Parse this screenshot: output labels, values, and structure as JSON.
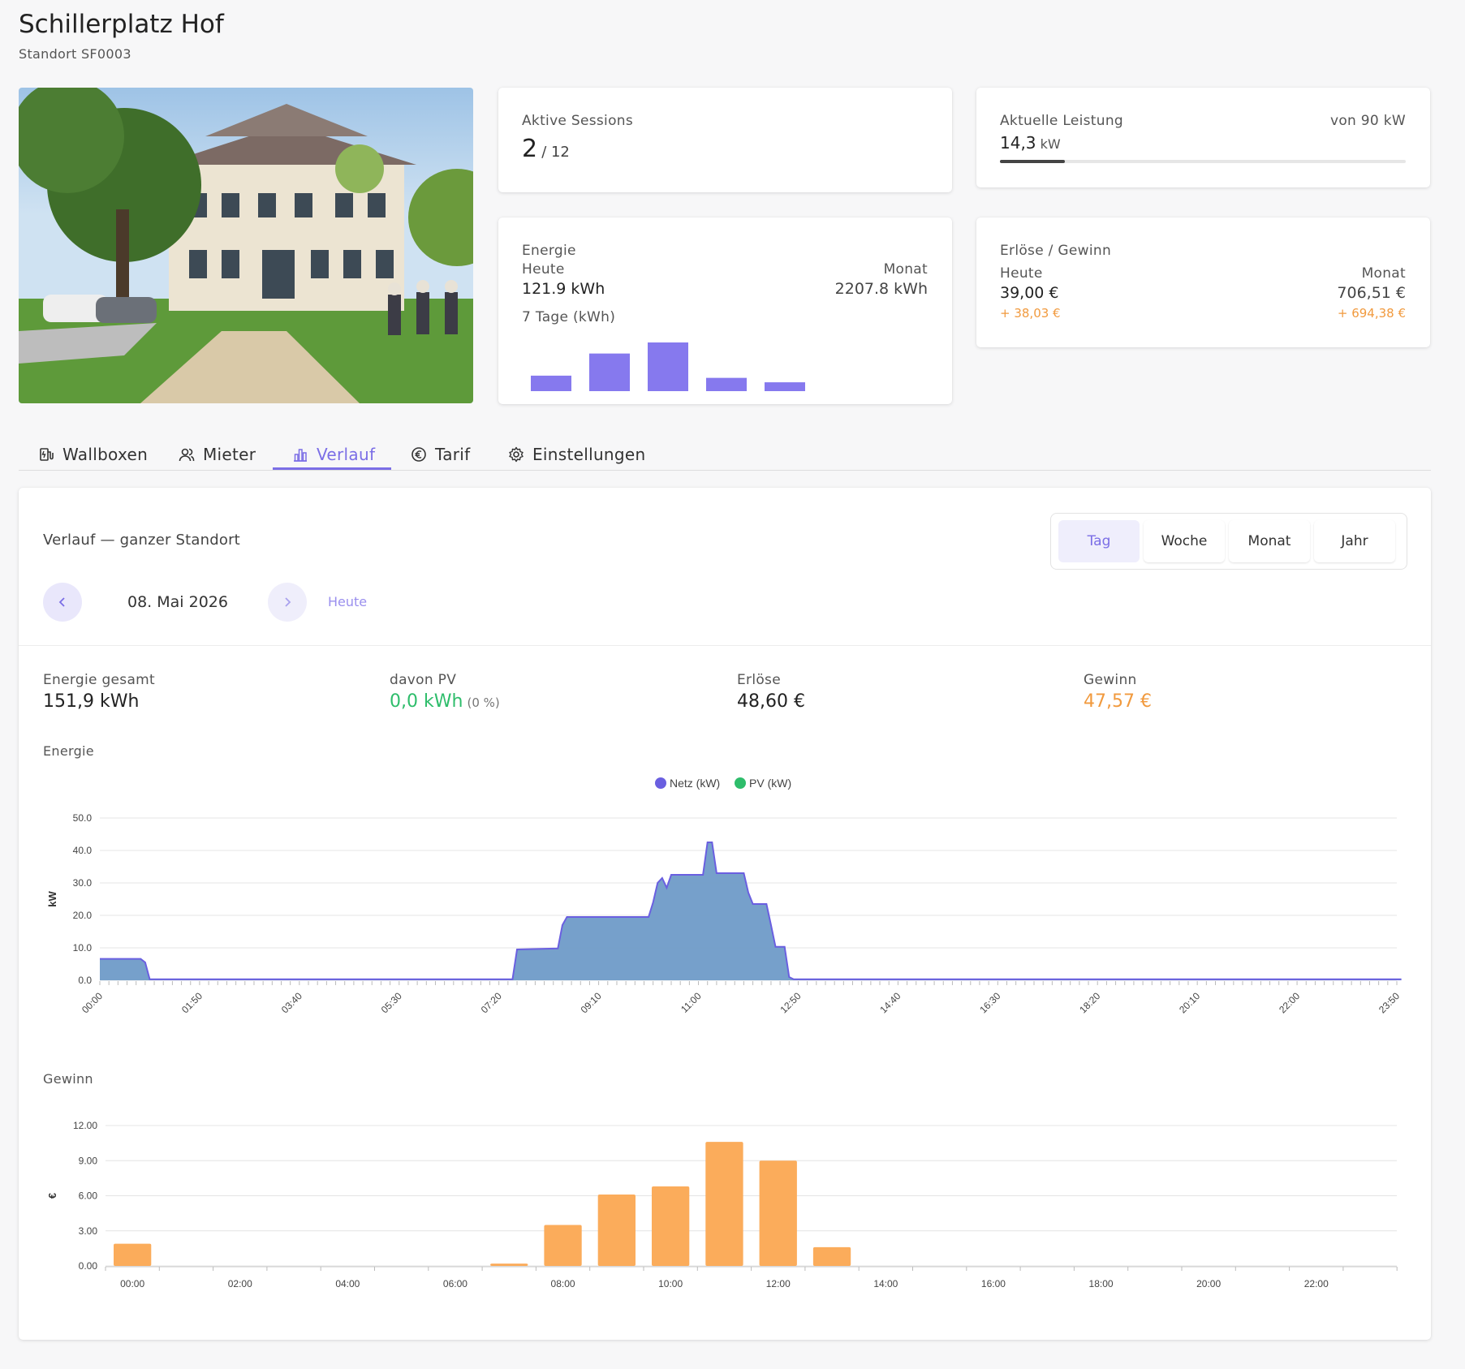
{
  "header": {
    "title": "Schillerplatz Hof",
    "subtitle": "Standort SF0003"
  },
  "kpis": {
    "sessions": {
      "label": "Aktive Sessions",
      "value": "2",
      "total": "/ 12"
    },
    "power": {
      "label": "Aktuelle Leistung",
      "value": "14,3",
      "unit": "kW",
      "max_label": "von 90 kW",
      "fraction": 0.159
    },
    "energy": {
      "label": "Energie",
      "today_label": "Heute",
      "today_value": "121.9 kWh",
      "month_label": "Monat",
      "month_value": "2207.8 kWh",
      "week_label": "7 Tage (kWh)",
      "week_values": [
        35,
        85,
        110,
        30,
        20
      ]
    },
    "revenue": {
      "label": "Erlöse / Gewinn",
      "today_label": "Heute",
      "today_value": "39,00 €",
      "today_profit": "+ 38,03 €",
      "month_label": "Monat",
      "month_value": "706,51 €",
      "month_profit": "+ 694,38 €"
    }
  },
  "tabs": [
    {
      "label": "Wallboxen",
      "icon": "wallbox-icon"
    },
    {
      "label": "Mieter",
      "icon": "users-icon"
    },
    {
      "label": "Verlauf",
      "icon": "chart-icon",
      "active": true
    },
    {
      "label": "Tarif",
      "icon": "euro-icon"
    },
    {
      "label": "Einstellungen",
      "icon": "gear-icon"
    }
  ],
  "history": {
    "title": "Verlauf — ganzer Standort",
    "periods": [
      "Tag",
      "Woche",
      "Monat",
      "Jahr"
    ],
    "active_period": "Tag",
    "date": "08. Mai 2026",
    "today_label": "Heute",
    "stats": {
      "energy_label": "Energie gesamt",
      "energy_value": "151,9 kWh",
      "pv_label": "davon PV",
      "pv_value": "0,0 kWh",
      "pv_pct": "(0 %)",
      "revenue_label": "Erlöse",
      "revenue_value": "48,60 €",
      "profit_label": "Gewinn",
      "profit_value": "47,57 €"
    },
    "energy_chart_label": "Energie",
    "profit_chart_label": "Gewinn"
  },
  "colors": {
    "accent": "#7b6ee6",
    "netz": "#6a5fe0",
    "area": "#6f9bc8",
    "pv": "#2ebd6b",
    "profit": "#fbac5b"
  },
  "chart_data": [
    {
      "type": "area",
      "title": "",
      "ylabel": "kW",
      "ylim": [
        0,
        50
      ],
      "yticks": [
        "0.0",
        "10.0",
        "20.0",
        "30.0",
        "40.0",
        "50.0"
      ],
      "xticks": [
        "00:00",
        "01:50",
        "03:40",
        "05:30",
        "07:20",
        "09:10",
        "11:00",
        "12:50",
        "14:40",
        "16:30",
        "18:20",
        "20:10",
        "22:00",
        "23:50"
      ],
      "legend": [
        "Netz (kW)",
        "PV (kW)"
      ],
      "series": [
        {
          "name": "Netz (kW)",
          "points": [
            [
              "00:00",
              6.6
            ],
            [
              "00:45",
              6.6
            ],
            [
              "00:50",
              5.5
            ],
            [
              "00:55",
              0.3
            ],
            [
              "07:35",
              0.3
            ],
            [
              "07:40",
              9.5
            ],
            [
              "08:25",
              9.8
            ],
            [
              "08:30",
              17
            ],
            [
              "08:35",
              19.5
            ],
            [
              "10:05",
              19.5
            ],
            [
              "10:10",
              24
            ],
            [
              "10:15",
              30
            ],
            [
              "10:20",
              31.5
            ],
            [
              "10:25",
              28.5
            ],
            [
              "10:30",
              32.5
            ],
            [
              "11:05",
              32.5
            ],
            [
              "11:10",
              42.5
            ],
            [
              "11:15",
              42.5
            ],
            [
              "11:20",
              33
            ],
            [
              "11:50",
              33
            ],
            [
              "11:55",
              27
            ],
            [
              "12:00",
              23.5
            ],
            [
              "12:15",
              23.5
            ],
            [
              "12:20",
              17
            ],
            [
              "12:25",
              10.3
            ],
            [
              "12:35",
              10.3
            ],
            [
              "12:40",
              1
            ],
            [
              "12:45",
              0.3
            ],
            [
              "23:55",
              0.3
            ]
          ]
        },
        {
          "name": "PV (kW)",
          "points": []
        }
      ]
    },
    {
      "type": "bar",
      "title": "",
      "ylabel": "€",
      "ylim": [
        0,
        12
      ],
      "yticks": [
        "0.00",
        "3.00",
        "6.00",
        "9.00",
        "12.00"
      ],
      "xticks": [
        "00:00",
        "02:00",
        "04:00",
        "06:00",
        "08:00",
        "10:00",
        "12:00",
        "14:00",
        "16:00",
        "18:00",
        "20:00",
        "22:00"
      ],
      "categories": [
        "00",
        "01",
        "02",
        "03",
        "04",
        "05",
        "06",
        "07",
        "08",
        "09",
        "10",
        "11",
        "12",
        "13",
        "14",
        "15",
        "16",
        "17",
        "18",
        "19",
        "20",
        "21",
        "22",
        "23"
      ],
      "values": [
        1.9,
        0,
        0,
        0,
        0,
        0,
        0,
        0.2,
        3.5,
        6.1,
        6.8,
        10.6,
        9.0,
        1.6,
        0,
        0,
        0,
        0,
        0,
        0,
        0,
        0,
        0,
        0
      ]
    }
  ]
}
